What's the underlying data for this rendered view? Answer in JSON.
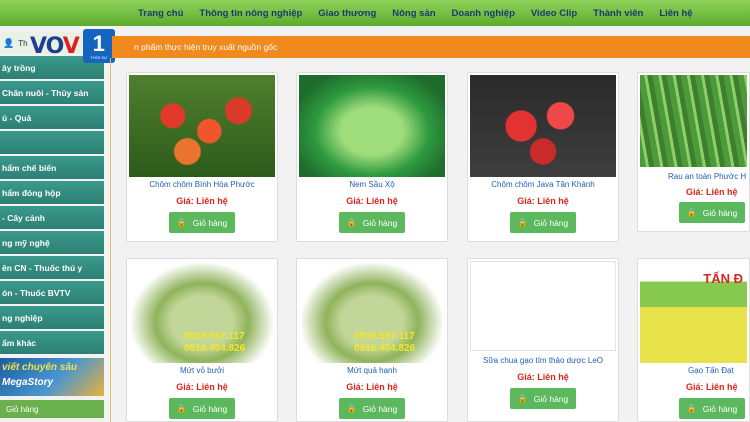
{
  "nav": {
    "items": [
      "Trang chủ",
      "Thông tin nông nghiệp",
      "Giao thương",
      "Nông sản",
      "Doanh nghiệp",
      "Video Clip",
      "Thành viên",
      "Liên hệ"
    ]
  },
  "logo": {
    "vov_left": "VO",
    "vov_mid": "V",
    "badge_number": "1",
    "badge_text": "THỜI SỰ"
  },
  "sidebar": {
    "head_label": "Th",
    "items": [
      "ây trồng",
      "Chăn nuôi - Thủy sản",
      "ủ - Quả",
      "",
      "hẩm chế biến",
      "hẩm đóng hộp",
      "- Cây cảnh",
      "ng mỹ nghệ",
      "ên CN - Thuốc thú y",
      "ón - Thuốc BVTV",
      "ng nghiệp",
      "ẩm khác"
    ],
    "banner_line1": "viết chuyên sâu",
    "banner_line2": "MegaStory",
    "cart_label": "Giỏ hàng"
  },
  "content": {
    "bar_text": "n phẩm thực hiện truy xuất nguồn gốc"
  },
  "products": [
    {
      "title": "Chôm chôm Bình Hòa Phước",
      "price": "Giá: Liên hệ",
      "cart": "Giỏ hàng"
    },
    {
      "title": "Nem Sầu Xộ",
      "price": "Giá: Liên hệ",
      "cart": "Giỏ hàng"
    },
    {
      "title": "Chôm chôm Java Tân Khánh",
      "price": "Giá: Liên hệ",
      "cart": "Giỏ hàng"
    },
    {
      "title": "Rau an toàn Phước H",
      "price": "Giá: Liên hệ",
      "cart": "Giỏ hàng"
    },
    {
      "title": "Mứt vỏ bưởi",
      "price": "Giá: Liên hệ",
      "cart": "Giỏ hàng",
      "overlay1": "0919.567.117",
      "overlay2": "0918.404.826"
    },
    {
      "title": "Mứt quả hạnh",
      "price": "Giá: Liên hệ",
      "cart": "Giỏ hàng",
      "overlay1": "0919.567.117",
      "overlay2": "0918.404.826"
    },
    {
      "title": "Sữa chua gạo tím thảo dược LeO",
      "price": "Giá: Liên hệ",
      "cart": "Giỏ hàng"
    },
    {
      "title": "Gạo Tấn Đạt",
      "price": "Giá: Liên hệ",
      "cart": "Giỏ hàng",
      "overlay1": "TẤN Đ"
    }
  ],
  "icons": {
    "user": "user-icon",
    "lock": "lock-icon"
  }
}
